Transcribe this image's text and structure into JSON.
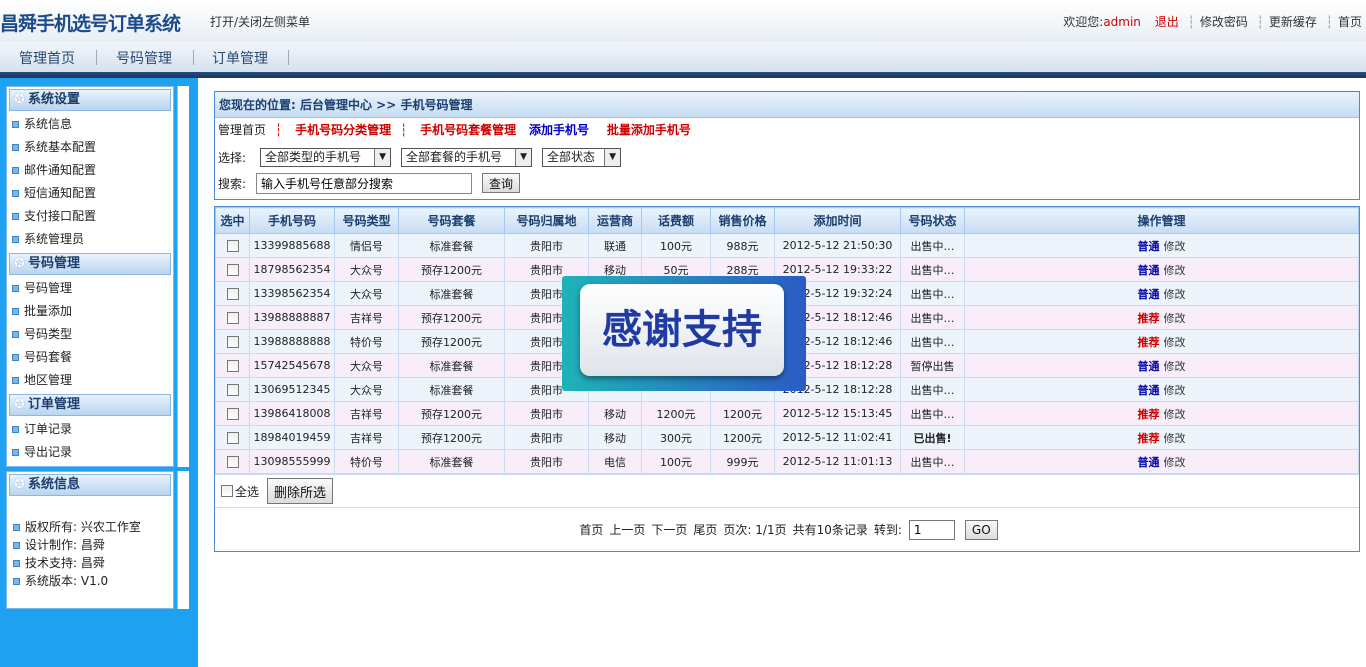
{
  "header": {
    "title": "昌舜手机选号订单系统",
    "toggle_menu": "打开/关闭左侧菜单",
    "welcome_prefix": "欢迎您:",
    "username": "admin",
    "logout": "退出",
    "change_password": "修改密码",
    "update_cache": "更新缓存",
    "home": "首页"
  },
  "nav": {
    "items": [
      "管理首页",
      "号码管理",
      "订单管理"
    ]
  },
  "sidebar": {
    "groups": [
      {
        "title": "系统设置",
        "items": [
          "系统信息",
          "系统基本配置",
          "邮件通知配置",
          "短信通知配置",
          "支付接口配置",
          "系统管理员"
        ]
      },
      {
        "title": "号码管理",
        "items": [
          "号码管理",
          "批量添加",
          "号码类型",
          "号码套餐",
          "地区管理"
        ]
      },
      {
        "title": "订单管理",
        "items": [
          "订单记录",
          "导出记录"
        ]
      }
    ],
    "info": {
      "title": "系统信息",
      "lines": [
        "版权所有: 兴农工作室",
        "设计制作: 昌舜",
        "技术支持: 昌舜",
        "系统版本: V1.0"
      ]
    }
  },
  "main": {
    "breadcrumb": "您现在的位置: 后台管理中心 >> 手机号码管理",
    "links": {
      "home": "管理首页",
      "category": "手机号码分类管理",
      "package": "手机号码套餐管理",
      "add": "添加手机号",
      "batch_add": "批量添加手机号"
    },
    "filter": {
      "label": "选择:",
      "type_select": "全部类型的手机号",
      "package_select": "全部套餐的手机号",
      "status_select": "全部状态"
    },
    "search": {
      "label": "搜索:",
      "value": "输入手机号任意部分搜索",
      "button": "查询"
    },
    "table": {
      "headers": [
        "选中",
        "手机号码",
        "号码类型",
        "号码套餐",
        "号码归属地",
        "运营商",
        "话费额",
        "销售价格",
        "添加时间",
        "号码状态",
        "操作管理"
      ],
      "rows": [
        {
          "phone": "13399885688",
          "type": "情侣号",
          "package": "标准套餐",
          "region": "贵阳市",
          "carrier": "联通",
          "credit": "100元",
          "price": "988元",
          "time": "2012-5-12 21:50:30",
          "status": "出售中…",
          "op": "普通",
          "edit": "修改",
          "status_class": "st-green",
          "op_class": "op-normal"
        },
        {
          "phone": "18798562354",
          "type": "大众号",
          "package": "预存1200元",
          "region": "贵阳市",
          "carrier": "移动",
          "credit": "50元",
          "price": "288元",
          "time": "2012-5-12 19:33:22",
          "status": "出售中…",
          "op": "普通",
          "edit": "修改",
          "status_class": "st-green",
          "op_class": "op-normal"
        },
        {
          "phone": "13398562354",
          "type": "大众号",
          "package": "标准套餐",
          "region": "贵阳市",
          "carrier": "",
          "credit": "",
          "price": "",
          "time": "2012-5-12 19:32:24",
          "status": "出售中…",
          "op": "普通",
          "edit": "修改",
          "status_class": "st-green",
          "op_class": "op-normal"
        },
        {
          "phone": "13988888887",
          "type": "吉祥号",
          "package": "预存1200元",
          "region": "贵阳市",
          "carrier": "",
          "credit": "",
          "price": "",
          "time": "2012-5-12 18:12:46",
          "status": "出售中…",
          "op": "推荐",
          "edit": "修改",
          "status_class": "st-green",
          "op_class": "op-rec"
        },
        {
          "phone": "13988888888",
          "type": "特价号",
          "package": "预存1200元",
          "region": "贵阳市",
          "carrier": "",
          "credit": "",
          "price": "",
          "time": "2012-5-12 18:12:46",
          "status": "出售中…",
          "op": "推荐",
          "edit": "修改",
          "status_class": "st-green",
          "op_class": "op-rec"
        },
        {
          "phone": "15742545678",
          "type": "大众号",
          "package": "标准套餐",
          "region": "贵阳市",
          "carrier": "",
          "credit": "",
          "price": "",
          "time": "2012-5-12 18:12:28",
          "status": "暂停出售",
          "op": "普通",
          "edit": "修改",
          "status_class": "st-red",
          "op_class": "op-normal"
        },
        {
          "phone": "13069512345",
          "type": "大众号",
          "package": "标准套餐",
          "region": "贵阳市",
          "carrier": "",
          "credit": "",
          "price": "",
          "time": "2012-5-12 18:12:28",
          "status": "出售中…",
          "op": "普通",
          "edit": "修改",
          "status_class": "st-green",
          "op_class": "op-normal"
        },
        {
          "phone": "13986418008",
          "type": "吉祥号",
          "package": "预存1200元",
          "region": "贵阳市",
          "carrier": "移动",
          "credit": "1200元",
          "price": "1200元",
          "time": "2012-5-12 15:13:45",
          "status": "出售中…",
          "op": "推荐",
          "edit": "修改",
          "status_class": "st-green",
          "op_class": "op-rec"
        },
        {
          "phone": "18984019459",
          "type": "吉祥号",
          "package": "预存1200元",
          "region": "贵阳市",
          "carrier": "移动",
          "credit": "300元",
          "price": "1200元",
          "time": "2012-5-12 11:02:41",
          "status": "已出售!",
          "op": "推荐",
          "edit": "修改",
          "status_class": "st-blue",
          "op_class": "op-rec"
        },
        {
          "phone": "13098555999",
          "type": "特价号",
          "package": "标准套餐",
          "region": "贵阳市",
          "carrier": "电信",
          "credit": "100元",
          "price": "999元",
          "time": "2012-5-12 11:01:13",
          "status": "出售中…",
          "op": "普通",
          "edit": "修改",
          "status_class": "st-green",
          "op_class": "op-normal"
        }
      ]
    },
    "select_all": "全选",
    "delete_selected": "删除所选",
    "pager": {
      "first": "首页",
      "prev": "上一页",
      "next": "下一页",
      "last": "尾页",
      "pages": "页次: 1/1页",
      "total": "共有10条记录",
      "goto": "转到:",
      "page_value": "1",
      "go": "GO"
    }
  },
  "overlay": {
    "text": "感谢支持"
  },
  "colors": {
    "sidebar_bg": "#1ea1f0",
    "header_text": "#1b4b8a",
    "red": "#d00000",
    "green": "#008000",
    "blue": "#0000aa"
  }
}
